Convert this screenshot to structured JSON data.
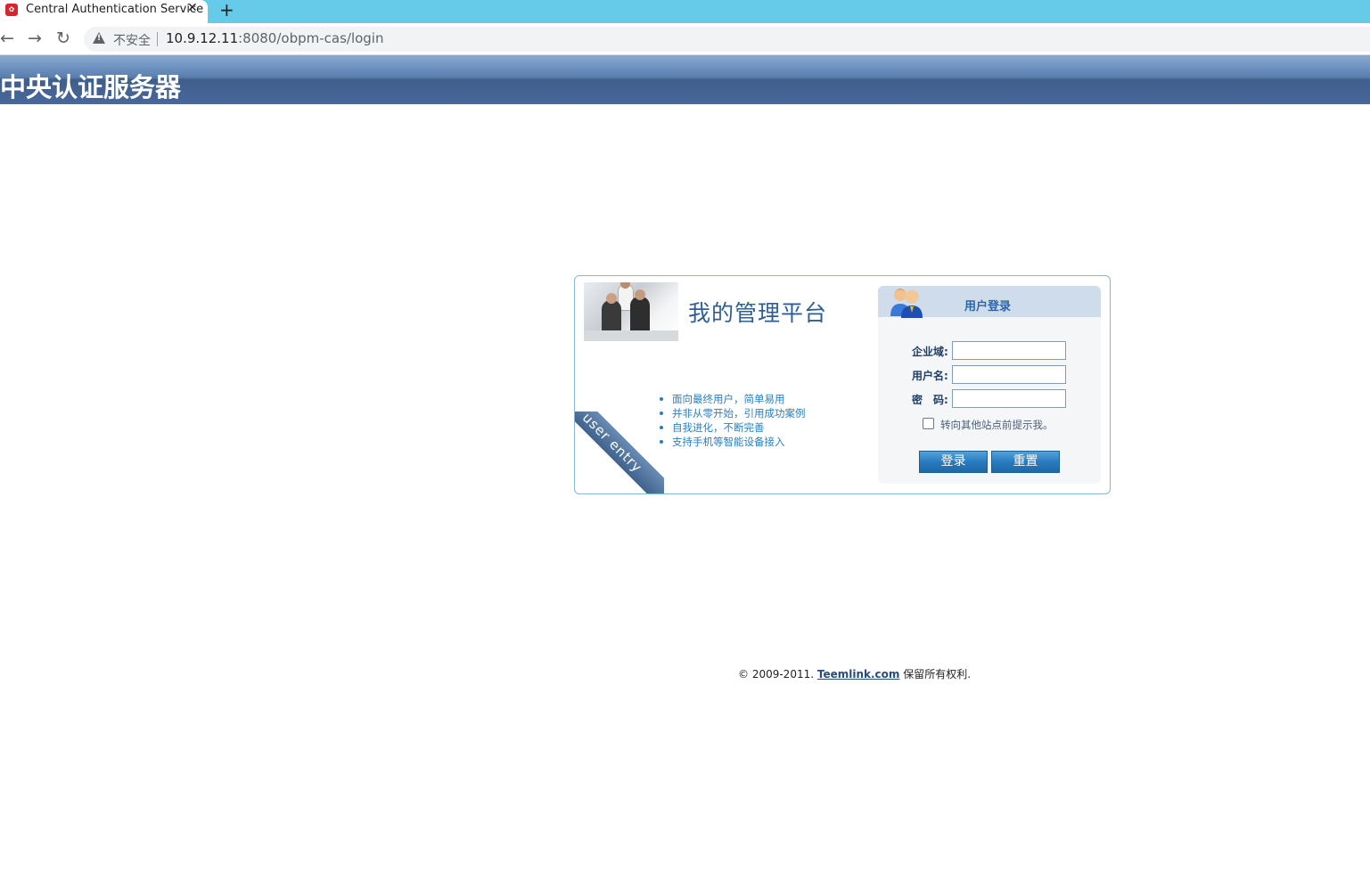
{
  "browser": {
    "tab_title": "Central Authentication Service",
    "tab_close": "✕",
    "new_tab": "+",
    "security_label": "不安全",
    "url_host": "10.9.12.11",
    "url_rest": ":8080/obpm-cas/login"
  },
  "header": {
    "title": "中央认证服务器"
  },
  "panel": {
    "platform_title": "我的管理平台",
    "features": [
      "面向最终用户，简单易用",
      "并非从零开始，引用成功案例",
      "自我进化，不断完善",
      "支持手机等智能设备接入"
    ],
    "ribbon_text": "user entry"
  },
  "login": {
    "heading": "用户登录",
    "domain_label": "企业域:",
    "username_label": "用户名:",
    "password_label": "密　码:",
    "domain_value": "",
    "username_value": "",
    "password_value": "",
    "remember_label": "转向其他站点前提示我。",
    "login_button": "登录",
    "reset_button": "重置"
  },
  "footer": {
    "copyright": "© 2009-2011.",
    "link_text": "Teemlink.com",
    "rights": "保留所有权利."
  },
  "colors": {
    "tabbar": "#66cbe8",
    "banner": "#4a6c9c",
    "accent_blue": "#2a7ec2",
    "button": "#2a7bbf"
  }
}
